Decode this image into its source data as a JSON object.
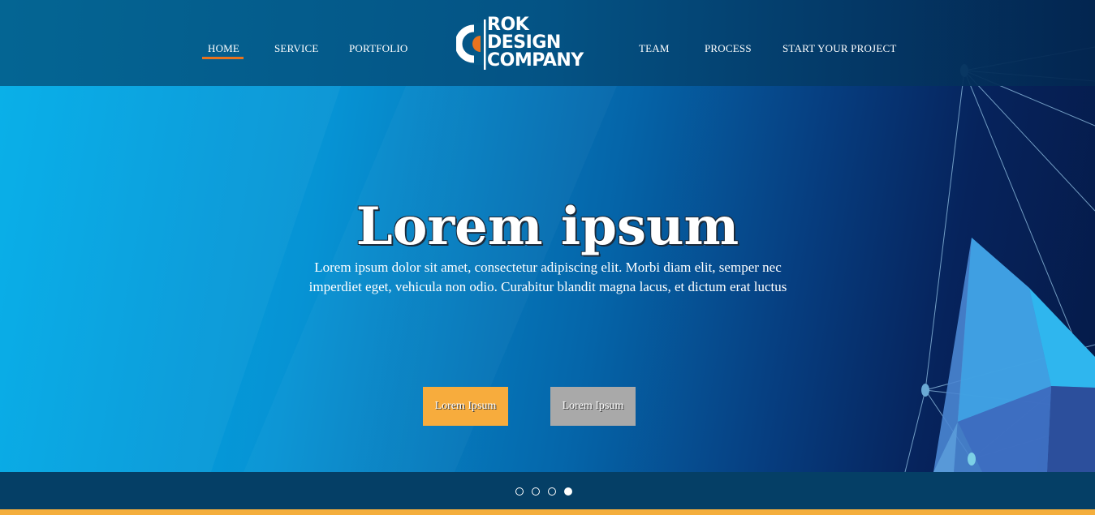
{
  "nav": {
    "left_items": [
      {
        "label": "HOME",
        "active": true
      },
      {
        "label": "SERVICE"
      },
      {
        "label": "PORTFOLIO"
      }
    ],
    "right_items": [
      {
        "label": "TEAM"
      },
      {
        "label": "PROCESS"
      },
      {
        "label": "START YOUR PROJECT"
      }
    ]
  },
  "logo": {
    "line1": "ROK",
    "line2": "DESIGN",
    "line3": "COMPANY",
    "icon": "rok-c-logo-icon"
  },
  "hero": {
    "title": "Lorem ipsum",
    "description": "Lorem ipsum dolor sit amet, consectetur adipiscing elit. Morbi diam elit, semper nec imperdiet eget, vehicula non odio. Curabitur blandit magna lacus, et dictum erat luctus",
    "primary_button": "Lorem Ipsum",
    "secondary_button": "Lorem Ipsum"
  },
  "slider": {
    "dot_count": 4,
    "active_index": 3
  },
  "colors": {
    "accent_orange": "#e8731e",
    "primary_button": "#f7ac3d",
    "secondary_button": "#a9a9a9",
    "bottom_strip": "#f4ae3c",
    "dots_bar": "#053f66"
  }
}
